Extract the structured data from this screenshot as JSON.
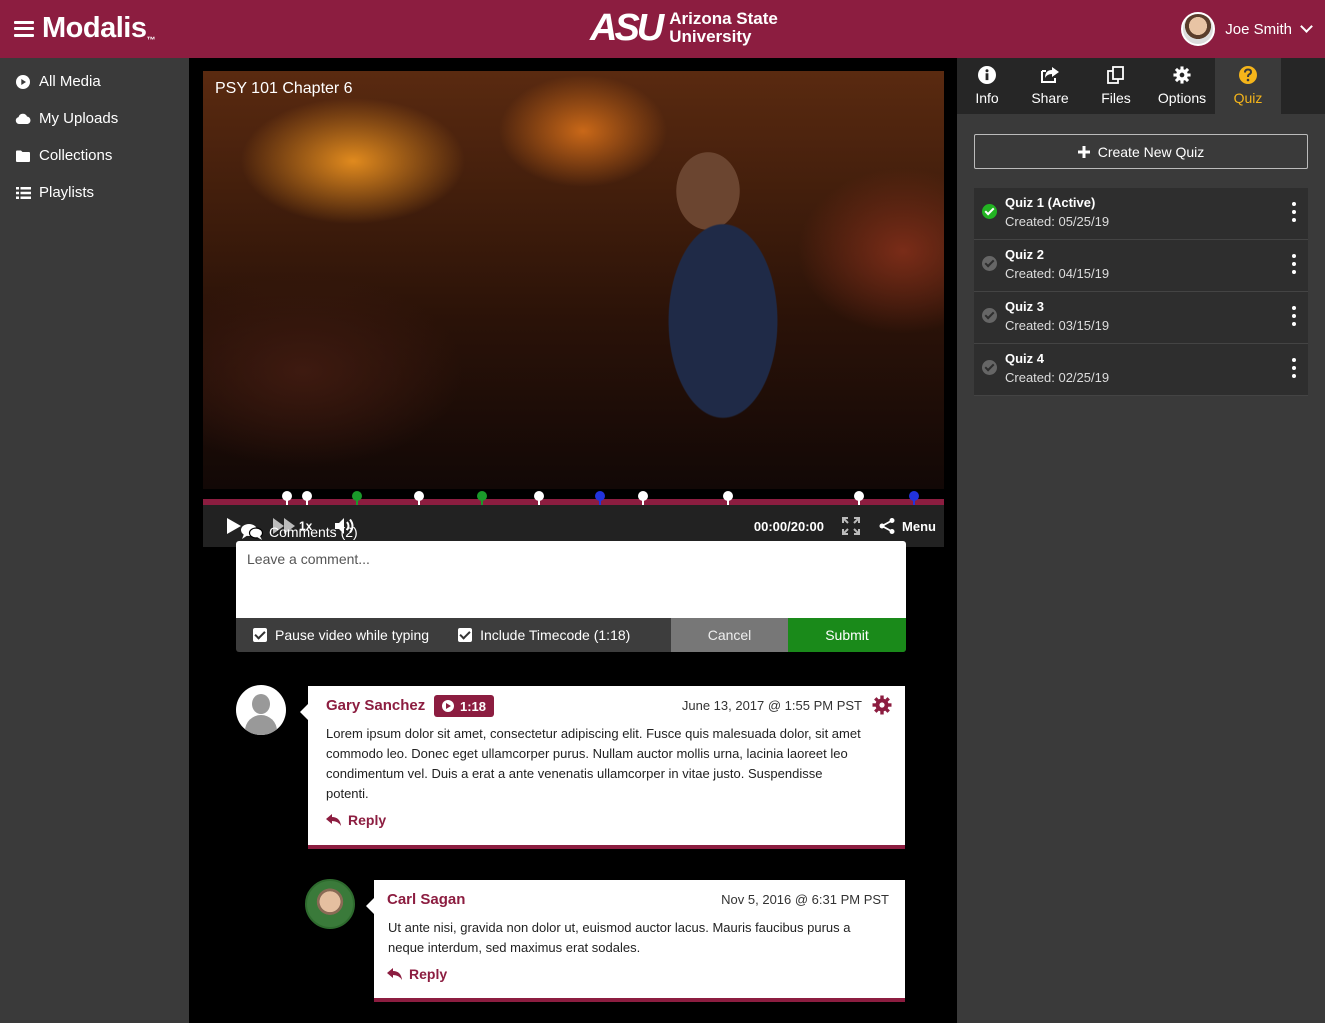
{
  "header": {
    "brand": "Modalis",
    "brand_tm": "™",
    "university_mark": "ASU",
    "university_line1": "Arizona State",
    "university_line2": "University",
    "user_name": "Joe Smith"
  },
  "sidebar": {
    "items": [
      {
        "label": "All Media",
        "icon": "play-circle-icon"
      },
      {
        "label": "My Uploads",
        "icon": "cloud-icon"
      },
      {
        "label": "Collections",
        "icon": "folder-icon"
      },
      {
        "label": "Playlists",
        "icon": "list-icon"
      }
    ]
  },
  "video": {
    "title": "PSY 101 Chapter 6",
    "speed": "1x",
    "time": "00:00/20:00",
    "menu_label": "Menu",
    "markers": [
      {
        "pos": 0.113,
        "color": "#ffffff"
      },
      {
        "pos": 0.14,
        "color": "#ffffff"
      },
      {
        "pos": 0.208,
        "color": "#1a9a2a"
      },
      {
        "pos": 0.292,
        "color": "#ffffff"
      },
      {
        "pos": 0.376,
        "color": "#1a9a2a"
      },
      {
        "pos": 0.454,
        "color": "#ffffff"
      },
      {
        "pos": 0.536,
        "color": "#2233dd"
      },
      {
        "pos": 0.594,
        "color": "#ffffff"
      },
      {
        "pos": 0.708,
        "color": "#ffffff"
      },
      {
        "pos": 0.885,
        "color": "#ffffff"
      },
      {
        "pos": 0.96,
        "color": "#2233dd"
      }
    ]
  },
  "comments": {
    "heading": "Comments (2)",
    "placeholder": "Leave a comment...",
    "pause_label": "Pause video while typing",
    "timecode_label": "Include Timecode (1:18)",
    "cancel_label": "Cancel",
    "submit_label": "Submit",
    "items": [
      {
        "author": "Gary Sanchez",
        "timecode": "1:18",
        "date": "June 13, 2017 @ 1:55 PM PST",
        "body_lines": [
          "Lorem ipsum dolor sit amet, consectetur adipiscing elit. Fusce quis malesuada dolor, sit amet",
          "commodo leo. Donec eget ullamcorper purus. Nullam auctor mollis urna, lacinia laoreet leo",
          "condimentum vel. Duis a erat a ante venenatis ullamcorper in vitae justo. Suspendisse",
          "potenti."
        ],
        "reply_label": "Reply"
      },
      {
        "author": "Carl Sagan",
        "date": "Nov 5, 2016 @ 6:31 PM PST",
        "body_lines": [
          "Ut ante nisi, gravida non dolor ut, euismod auctor lacus. Mauris faucibus purus a",
          "neque interdum, sed maximus erat sodales."
        ],
        "reply_label": "Reply"
      }
    ]
  },
  "panel": {
    "tabs": [
      {
        "label": "Info",
        "icon": "info-icon"
      },
      {
        "label": "Share",
        "icon": "share-icon"
      },
      {
        "label": "Files",
        "icon": "files-icon"
      },
      {
        "label": "Options",
        "icon": "gear-icon"
      },
      {
        "label": "Quiz",
        "icon": "question-icon",
        "active": true
      }
    ],
    "create_label": "Create New Quiz",
    "quizzes": [
      {
        "name": "Quiz 1 (Active)",
        "created": "Created: 05/25/19",
        "active": true
      },
      {
        "name": "Quiz 2",
        "created": "Created: 04/15/19",
        "active": false
      },
      {
        "name": "Quiz 3",
        "created": "Created: 03/15/19",
        "active": false
      },
      {
        "name": "Quiz 4",
        "created": "Created: 02/25/19",
        "active": false
      }
    ]
  },
  "colors": {
    "brand": "#8c1d40",
    "accent_quiz": "#f5b51a",
    "submit": "#1a8a1a"
  }
}
